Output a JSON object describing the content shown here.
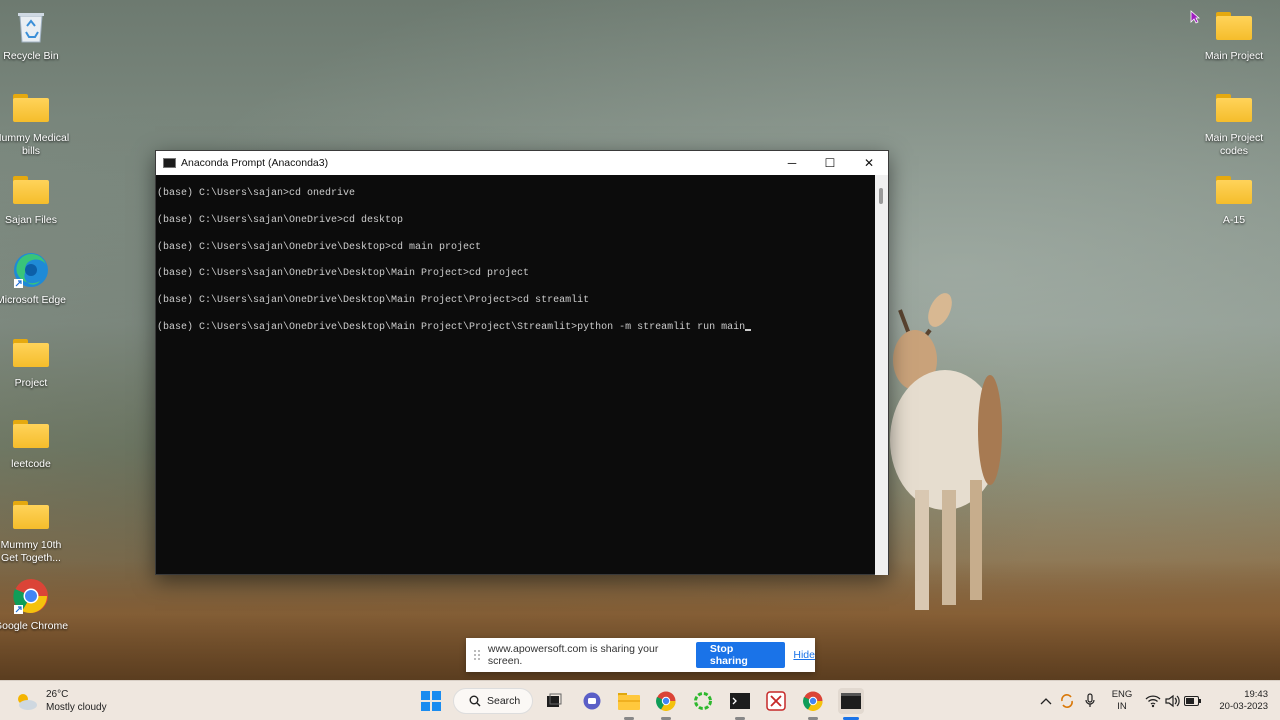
{
  "desktop": {
    "left_icons": [
      {
        "label": "Recycle Bin",
        "icon": "recycle-bin-icon"
      },
      {
        "label": "Mummy Medical bills",
        "icon": "folder-icon"
      },
      {
        "label": "Sajan Files",
        "icon": "folder-icon"
      },
      {
        "label": "Microsoft Edge",
        "icon": "edge-icon"
      },
      {
        "label": "Project",
        "icon": "folder-icon"
      },
      {
        "label": "leetcode",
        "icon": "folder-icon"
      },
      {
        "label": "Mummy 10th Get Togeth...",
        "icon": "folder-icon"
      },
      {
        "label": "Google Chrome",
        "icon": "chrome-icon"
      }
    ],
    "right_icons": [
      {
        "label": "Main Project",
        "icon": "folder-icon"
      },
      {
        "label": "Main Project codes",
        "icon": "folder-icon"
      },
      {
        "label": "A-15",
        "icon": "folder-icon"
      }
    ]
  },
  "window": {
    "title": "Anaconda Prompt (Anaconda3)",
    "minimize": "─",
    "maximize": "☐",
    "close": "✕",
    "lines": [
      "(base) C:\\Users\\sajan>cd onedrive",
      "(base) C:\\Users\\sajan\\OneDrive>cd desktop",
      "(base) C:\\Users\\sajan\\OneDrive\\Desktop>cd main project",
      "(base) C:\\Users\\sajan\\OneDrive\\Desktop\\Main Project>cd project",
      "(base) C:\\Users\\sajan\\OneDrive\\Desktop\\Main Project\\Project>cd streamlit",
      "(base) C:\\Users\\sajan\\OneDrive\\Desktop\\Main Project\\Project\\Streamlit>python -m streamlit run main"
    ]
  },
  "share_bar": {
    "message": "www.apowersoft.com is sharing your screen.",
    "stop_label": "Stop sharing",
    "hide_label": "Hide"
  },
  "taskbar": {
    "weather_temp": "26°C",
    "weather_desc": "Mostly cloudy",
    "search_label": "Search",
    "language_top": "ENG",
    "language_bottom": "IN",
    "time": "19:43",
    "date": "20-03-2023"
  },
  "colors": {
    "terminal_bg": "#0c0c0c",
    "terminal_text": "#cccccc",
    "share_button": "#1a73e8",
    "taskbar_bg": "#efe7df"
  }
}
